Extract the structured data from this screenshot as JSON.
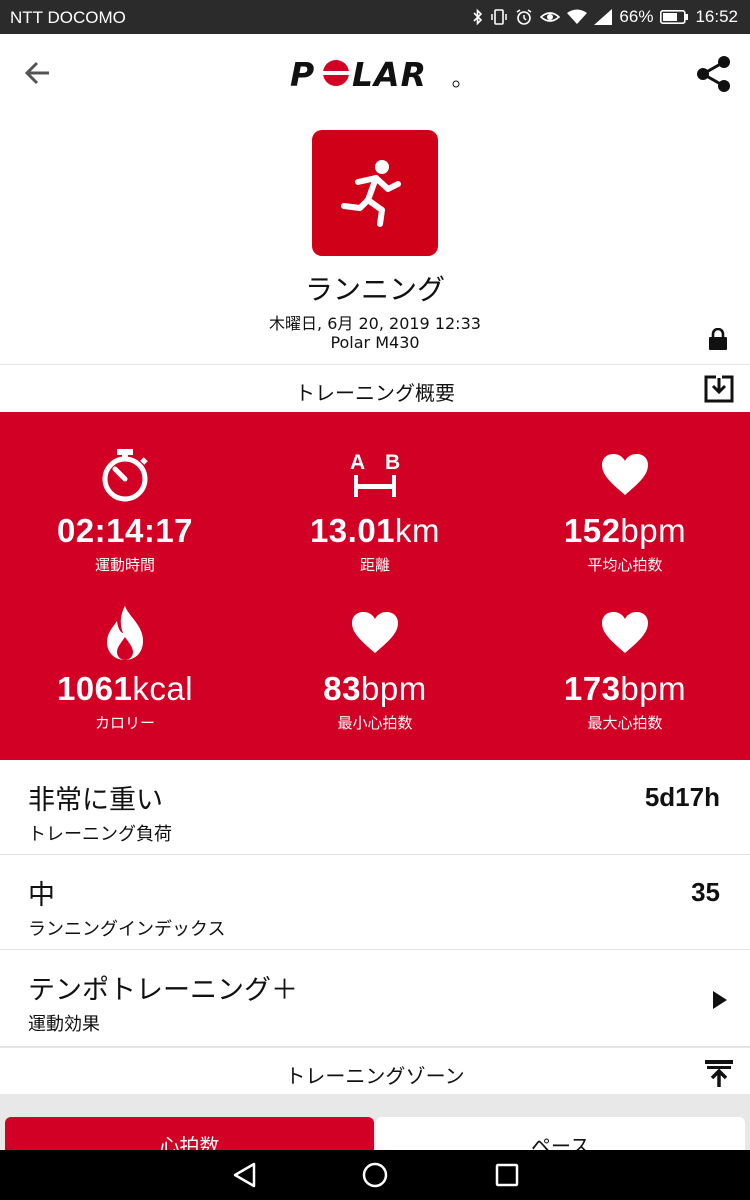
{
  "status_bar": {
    "carrier": "NTT DOCOMO",
    "battery": "66%",
    "time": "16:52"
  },
  "app_bar": {
    "logo": "POLAR",
    "back_icon": "back-arrow-icon",
    "share_icon": "share-icon"
  },
  "activity": {
    "sport": "ランニング",
    "datetime": "木曜日, 6月 20, 2019 12:33",
    "device": "Polar M430",
    "icon": "running-person-icon"
  },
  "summary_section": {
    "title": "トレーニング概要",
    "icon": "download-icon"
  },
  "stats": [
    {
      "icon": "stopwatch-icon",
      "value": "02:14:17",
      "unit": "",
      "label": "運動時間"
    },
    {
      "icon": "distance-ab-icon",
      "value": "13.01",
      "unit": "km",
      "label": "距離"
    },
    {
      "icon": "heart-icon",
      "value": "152",
      "unit": "bpm",
      "label": "平均心拍数"
    },
    {
      "icon": "flame-icon",
      "value": "1061",
      "unit": "kcal",
      "label": "カロリー"
    },
    {
      "icon": "heart-icon",
      "value": "83",
      "unit": "bpm",
      "label": "最小心拍数"
    },
    {
      "icon": "heart-icon",
      "value": "173",
      "unit": "bpm",
      "label": "最大心拍数"
    }
  ],
  "rows": [
    {
      "title": "非常に重い",
      "subtitle": "トレーニング負荷",
      "value": "5d17h"
    },
    {
      "title": "中",
      "subtitle": "ランニングインデックス",
      "value": "35"
    },
    {
      "title": "テンポトレーニング＋",
      "subtitle": "運動効果",
      "value": ""
    }
  ],
  "zones_section": {
    "title": "トレーニングゾーン",
    "icon": "collapse-icon"
  },
  "tabs": [
    {
      "label": "心拍数",
      "active": true
    },
    {
      "label": "ペース",
      "active": false
    }
  ],
  "colors": {
    "brand_red": "#d10024",
    "status_bar": "#2b2b2b"
  }
}
